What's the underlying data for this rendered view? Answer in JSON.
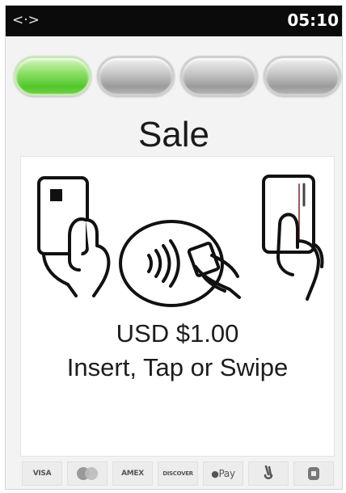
{
  "status_bar": {
    "left_icon": "network-arrows-icon",
    "left_glyph": "<·>",
    "time": "05:10"
  },
  "progress": {
    "total_steps": 4,
    "active_step": 1
  },
  "title": "Sale",
  "payment": {
    "amount": "USD $1.00",
    "instruction": "Insert, Tap or Swipe",
    "methods_illustrated": [
      "insert-card-icon",
      "contactless-tap-icon",
      "swipe-card-icon"
    ]
  },
  "accepted_brands": [
    {
      "icon": "visa-icon",
      "label": "VISA"
    },
    {
      "icon": "mastercard-icon",
      "label": ""
    },
    {
      "icon": "american-express-icon",
      "label": "AMEX"
    },
    {
      "icon": "discover-icon",
      "label": "DISCOVER"
    },
    {
      "icon": "apple-pay-icon",
      "label": "Pay"
    },
    {
      "icon": "google-pay-icon",
      "label": ""
    },
    {
      "icon": "samsung-pay-icon",
      "label": ""
    }
  ],
  "colors": {
    "status_bar": "#0b0b0b",
    "active_step": "#52c72b",
    "inactive_step": "#b4b4b4",
    "background": "#f3f3f3"
  }
}
